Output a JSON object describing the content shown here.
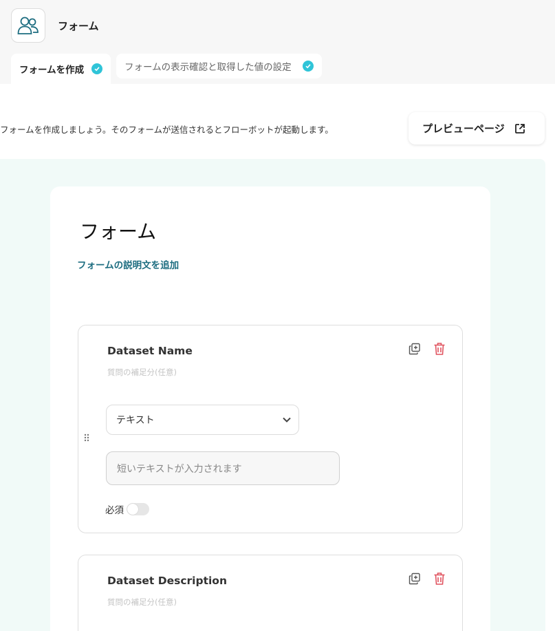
{
  "app": {
    "title": "フォーム",
    "icon": "users-icon"
  },
  "tabs": [
    {
      "label": "フォームを作成",
      "status": "check-circle-icon"
    },
    {
      "label": "フォームの表示確認と取得した値の設定",
      "status": "check-circle-icon"
    }
  ],
  "intro_text": "フォームを作成しましょう。そのフォームが送信されるとフローボットが起動します。",
  "preview_button": {
    "label": "プレビューページ",
    "icon": "external-link-icon"
  },
  "form": {
    "title": "フォーム",
    "add_description_link": "フォームの説明文を追加",
    "questions": [
      {
        "title": "Dataset Name",
        "subtitle": "質問の補足分(任意)",
        "type_label": "テキスト",
        "input_placeholder": "短いテキストが入力されます",
        "required_label": "必須",
        "required": false
      },
      {
        "title": "Dataset Description",
        "subtitle": "質問の補足分(任意)"
      }
    ]
  },
  "colors": {
    "accent": "#2fc4d8",
    "link": "#1d6d80",
    "delete": "#e0525e",
    "canvas_bg": "#f1faf8"
  }
}
